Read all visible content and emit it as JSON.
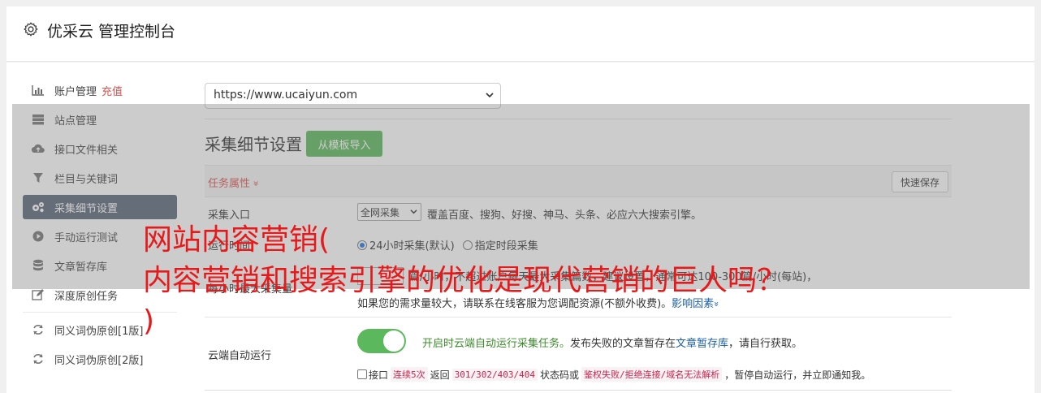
{
  "header": {
    "title": "优采云 管理控制台",
    "icon": "gear-icon"
  },
  "sidebar": {
    "items": [
      {
        "label": "账户管理",
        "sub": "充值",
        "icon": "bar-chart-icon"
      },
      {
        "label": "站点管理",
        "icon": "server-icon"
      },
      {
        "label": "接口文件相关",
        "icon": "cloud-upload-icon"
      },
      {
        "label": "栏目与关键词",
        "icon": "filter-icon"
      },
      {
        "label": "采集细节设置",
        "icon": "gears-icon",
        "active": true
      },
      {
        "label": "手动运行测试",
        "icon": "play-circle-icon"
      },
      {
        "label": "文章暂存库",
        "icon": "database-icon"
      },
      {
        "label": "深度原创任务",
        "icon": "edit-icon"
      },
      {
        "label": "同义词伪原创[1版]",
        "icon": "refresh-icon"
      },
      {
        "label": "同义词伪原创[2版]",
        "icon": "refresh-icon"
      }
    ]
  },
  "main": {
    "site_select": "https://www.ucaiyun.com",
    "section_title": "采集细节设置",
    "template_button": "从模板导入",
    "task_attr_label": "任务属性",
    "task_attr_chevron": "»",
    "quick_save": "快速保存",
    "source": {
      "label": "采集入口",
      "select": "全网采集",
      "desc": "覆盖百度、搜狗、好搜、神马、头条、必应六大搜索引擎。"
    },
    "run_time": {
      "label": "运行时间",
      "opt1": "24小时采集(默认)",
      "opt2": "指定时段采集"
    },
    "per_hour": {
      "label": "每小时最大采集量",
      "desc": "篇/小时，不超过账户每天最大采集篇数，建议设置，通常可达100-300篇/小时(每站)，",
      "desc2": "如果您的需求量较大，请联系在线客服为您调配资源(不额外收费)。",
      "link": "影响因素",
      "link_chevron": "»"
    },
    "cloud": {
      "label": "云端自动运行",
      "green_text": "开启时云端自动运行采集任务。",
      "desc": "发布失败的文章暂存在",
      "link": "文章暂存库",
      "desc_end": "，请自行获取。",
      "cb_label1": "接口",
      "code1": "连续5次",
      "text2": "返回",
      "code2": "301/302/403/404",
      "text3": "状态码或",
      "code3": "鉴权失败/拒绝连接/域名无法解析",
      "text4": "，暂停自动运行，并立即通知我。"
    }
  },
  "overlay_headline": {
    "line1": "网站内容营销(",
    "line2": "内容营销和搜索引擎的优化是现代营销的巨人吗？",
    "line3": ")"
  },
  "colors": {
    "accent_green": "#5cb85c",
    "active_sidebar": "#5a6778",
    "headline_red": "#e8191b",
    "link_blue": "#1a5fa8"
  }
}
